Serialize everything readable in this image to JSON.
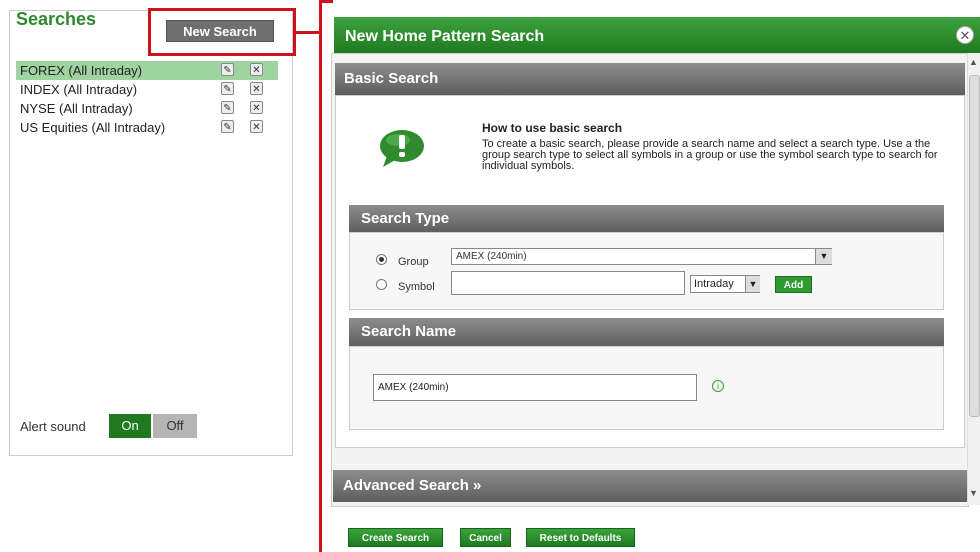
{
  "left_panel": {
    "title": "Searches",
    "new_search_label": "New Search",
    "items": [
      {
        "label": "FOREX (All Intraday)",
        "selected": true
      },
      {
        "label": "INDEX (All Intraday)",
        "selected": false
      },
      {
        "label": "NYSE (All Intraday)",
        "selected": false
      },
      {
        "label": "US Equities (All Intraday)",
        "selected": false
      }
    ],
    "alert_sound_label": "Alert sound",
    "alert_on_label": "On",
    "alert_off_label": "Off",
    "alert_sound_value": "On"
  },
  "dialog": {
    "title": "New Home Pattern Search",
    "basic_search_label": "Basic Search",
    "howto_title": "How to use basic search",
    "howto_text": "To create a basic search, please provide a search name and select a search type. Use a the group search type to select all symbols in a group or use the symbol search type to search for individual symbols.",
    "search_type_label": "Search Type",
    "group_label": "Group",
    "symbol_label": "Symbol",
    "group_value": "AMEX (240min)",
    "symbol_value": "",
    "interval_value": "Intraday",
    "add_label": "Add",
    "search_name_label": "Search Name",
    "search_name_value": "AMEX (240min)",
    "advanced_search_label": "Advanced Search »",
    "create_label": "Create Search",
    "cancel_label": "Cancel",
    "reset_label": "Reset to Defaults"
  },
  "colors": {
    "accent_green": "#2f9a2f",
    "highlight_red": "#d0101b",
    "bar_gray": "#6f6f6f"
  },
  "icons": [
    "edit-icon",
    "delete-icon",
    "close-icon",
    "exclamation-bubble-icon",
    "info-icon",
    "dropdown-arrow-icon",
    "radio-selected-icon"
  ]
}
